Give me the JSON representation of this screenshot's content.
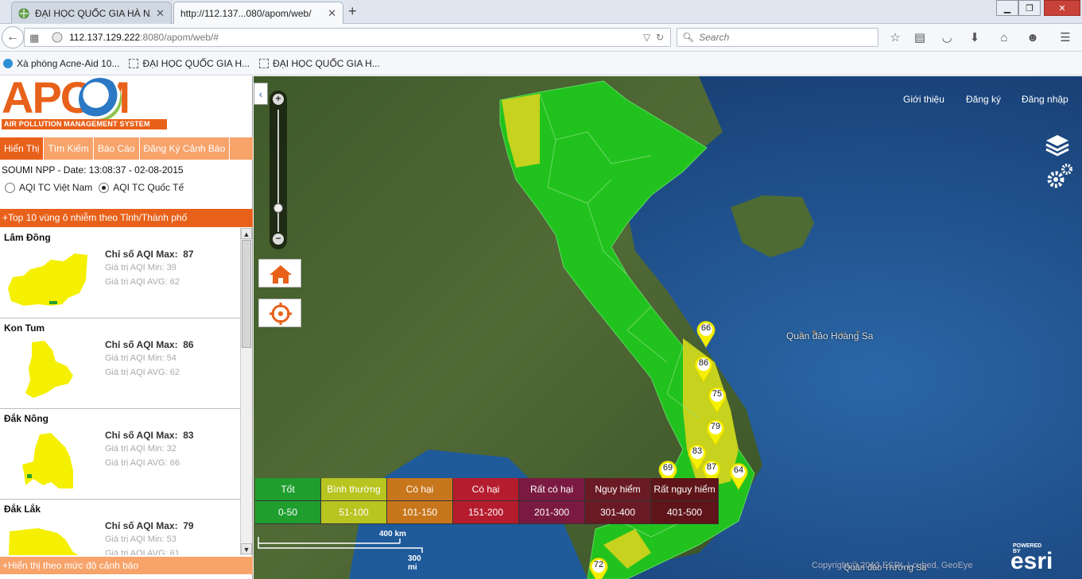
{
  "browser": {
    "tabs": [
      {
        "title": "ĐẠI HỌC QUỐC GIA HÀ N...",
        "active": false
      },
      {
        "title": "http://112.137...080/apom/web/",
        "active": true
      }
    ],
    "url_host": "112.137.129.222",
    "url_path": ":8080/apom/web/#",
    "search_placeholder": "Search",
    "bookmarks": [
      {
        "label": "Xà phòng Acne-Aid 10..."
      },
      {
        "label": "ĐẠI HỌC QUỐC GIA H..."
      },
      {
        "label": "ĐẠI HỌC QUỐC GIA H..."
      }
    ]
  },
  "app": {
    "logo_text": "APOM",
    "logo_sub": "AIR POLLUTION MANAGEMENT SYSTEM",
    "menu": [
      "Hiển Thị",
      "Tìm Kiếm",
      "Báo Cáo",
      "Đăng Ký Cảnh Báo"
    ],
    "station_info": "SOUMI NPP - Date: 13:08:37 - 02-08-2015",
    "radio_vn": "AQI TC Việt Nam",
    "radio_intl": "AQI TC Quốc Tế",
    "top10_header": "+Top 10 vùng ô nhiễm theo Tỉnh/Thành phố",
    "bottom_header": "+Hiển thị theo mức độ cảnh báo",
    "provinces": [
      {
        "name": "Lâm Đồng",
        "max_label": "Chỉ số AQI Max:",
        "max": "87",
        "min_label": "Giá trị AQI Min:",
        "min": "39",
        "avg_label": "Giá trị AQI AVG:",
        "avg": "62"
      },
      {
        "name": "Kon Tum",
        "max_label": "Chỉ số AQI Max:",
        "max": "86",
        "min_label": "Giá trị AQI Min:",
        "min": "54",
        "avg_label": "Giá trị AQI AVG:",
        "avg": "62"
      },
      {
        "name": "Đắk Nông",
        "max_label": "Chỉ số AQI Max:",
        "max": "83",
        "min_label": "Giá trị AQI Min:",
        "min": "32",
        "avg_label": "Giá trị AQI AVG:",
        "avg": "66"
      },
      {
        "name": "Đắk Lắk",
        "max_label": "Chỉ số AQI Max:",
        "max": "79",
        "min_label": "Giá trị AQI Min:",
        "min": "53",
        "avg_label": "Giá trị AQI AVG:",
        "avg": "61"
      }
    ]
  },
  "map": {
    "links": [
      "Giới thiệu",
      "Đăng ký",
      "Đăng nhập"
    ],
    "sea_label": "Quần đảo Hoàng Sa",
    "sea_label2": "Quần đảo Trường Sa",
    "copyright": "Copyright:© 2013 ESRI, i-cubed, GeoEye",
    "powered": "POWERED BY",
    "esri": "esri",
    "scale_km": "400 km",
    "scale_mi": "300 mi",
    "pins": [
      "66",
      "86",
      "75",
      "79",
      "83",
      "87",
      "69",
      "64",
      "72"
    ],
    "legend": [
      {
        "name": "Tốt",
        "range": "0-50",
        "color": "#1f9e2e"
      },
      {
        "name": "Bình thường",
        "range": "51-100",
        "color": "#b8c41f"
      },
      {
        "name": "Có hại",
        "range": "101-150",
        "color": "#c8761c"
      },
      {
        "name": "Có hại",
        "range": "151-200",
        "color": "#b51d2e"
      },
      {
        "name": "Rất có hại",
        "range": "201-300",
        "color": "#7b1a40"
      },
      {
        "name": "Nguy hiểm",
        "range": "301-400",
        "color": "#6a1a24"
      },
      {
        "name": "Rất nguy hiểm",
        "range": "401-500",
        "color": "#5e1418"
      }
    ]
  }
}
